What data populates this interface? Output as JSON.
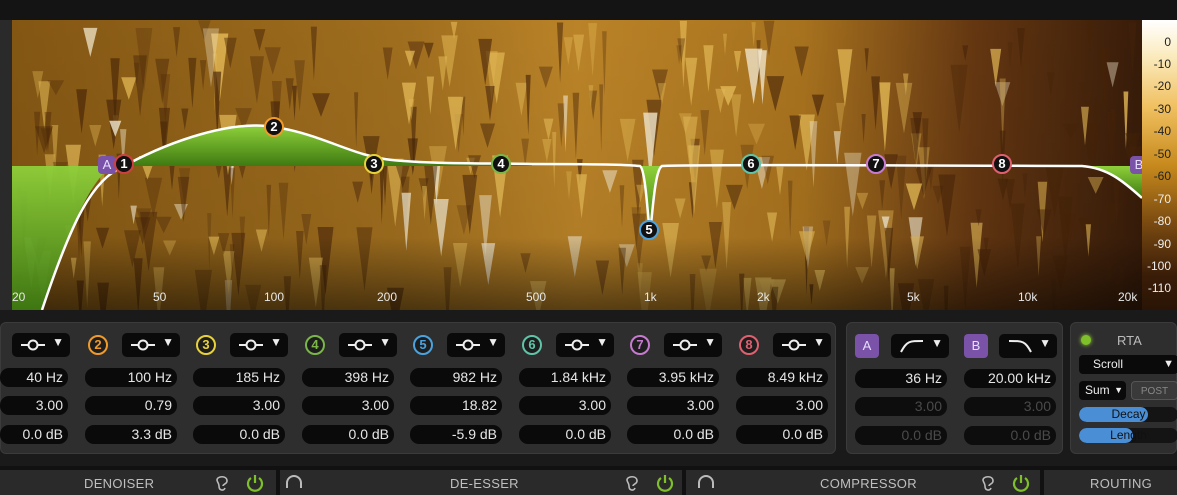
{
  "db_scale": [
    "0",
    "-10",
    "-20",
    "-30",
    "-40",
    "-50",
    "-60",
    "-70",
    "-80",
    "-90",
    "-100",
    "-110"
  ],
  "freq_axis": [
    "20",
    "50",
    "100",
    "200",
    "500",
    "1k",
    "2k",
    "5k",
    "10k",
    "20k"
  ],
  "curve_nodes": [
    "A",
    "1",
    "2",
    "3",
    "4",
    "5",
    "6",
    "7",
    "8",
    "B"
  ],
  "bands": [
    {
      "num": "",
      "freq": "40 Hz",
      "q": "3.00",
      "gain": "0.0 dB",
      "color": "#d04040"
    },
    {
      "num": "2",
      "freq": "100 Hz",
      "q": "0.79",
      "gain": "3.3 dB",
      "color": "#f09a2a"
    },
    {
      "num": "3",
      "freq": "185 Hz",
      "q": "3.00",
      "gain": "0.0 dB",
      "color": "#e8d23a"
    },
    {
      "num": "4",
      "freq": "398 Hz",
      "q": "3.00",
      "gain": "0.0 dB",
      "color": "#7ab648"
    },
    {
      "num": "5",
      "freq": "982 Hz",
      "q": "18.82",
      "gain": "-5.9 dB",
      "color": "#4aa3df"
    },
    {
      "num": "6",
      "freq": "1.84 kHz",
      "q": "3.00",
      "gain": "0.0 dB",
      "color": "#5fc4a8"
    },
    {
      "num": "7",
      "freq": "3.95 kHz",
      "q": "3.00",
      "gain": "0.0 dB",
      "color": "#c87ad0"
    },
    {
      "num": "8",
      "freq": "8.49 kHz",
      "q": "3.00",
      "gain": "0.0 dB",
      "color": "#e06070"
    }
  ],
  "filters": [
    {
      "label": "A",
      "freq": "36 Hz",
      "q": "3.00",
      "gain": "0.0 dB"
    },
    {
      "label": "B",
      "freq": "20.00 kHz",
      "q": "3.00",
      "gain": "0.0 dB"
    }
  ],
  "rta": {
    "label": "RTA",
    "mode": "Scroll",
    "source": "Sum",
    "post": "POST",
    "decay_label": "Decay",
    "decay_level": 0.7,
    "length_label": "Length",
    "length_level": 0.55
  },
  "modules": [
    "DENOISER",
    "DE-ESSER",
    "COMPRESSOR",
    "ROUTING"
  ],
  "colors": {
    "accent_green": "#7fbf2a",
    "filter_purple": "#7a52a8",
    "rta_blue": "#4a8fd6"
  }
}
